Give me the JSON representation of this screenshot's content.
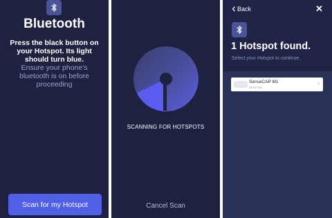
{
  "screen1": {
    "icon": "bluetooth-icon",
    "title": "Bluetooth",
    "instruction": "Press the black button on your Hotspot. Its light should turn blue.",
    "hint": "Ensure your phone's bluetooth is on before proceeding",
    "scan_button": "Scan for my Hotspot"
  },
  "screen2": {
    "status": "SCANNING FOR HOTSPOTS",
    "cancel": "Cancel Scan"
  },
  "screen3": {
    "back": "Back",
    "close_icon": "close-icon",
    "icon": "bluetooth-icon",
    "title": "1 Hotspot found.",
    "subtitle": "Select your Hotspot to continue.",
    "hotspots": [
      {
        "name": "SenseCAP M1",
        "id": "39 5F ED"
      }
    ]
  },
  "colors": {
    "background": "#1e2240",
    "accent": "#4f5fe6",
    "icon_badge": "#4b5498"
  }
}
